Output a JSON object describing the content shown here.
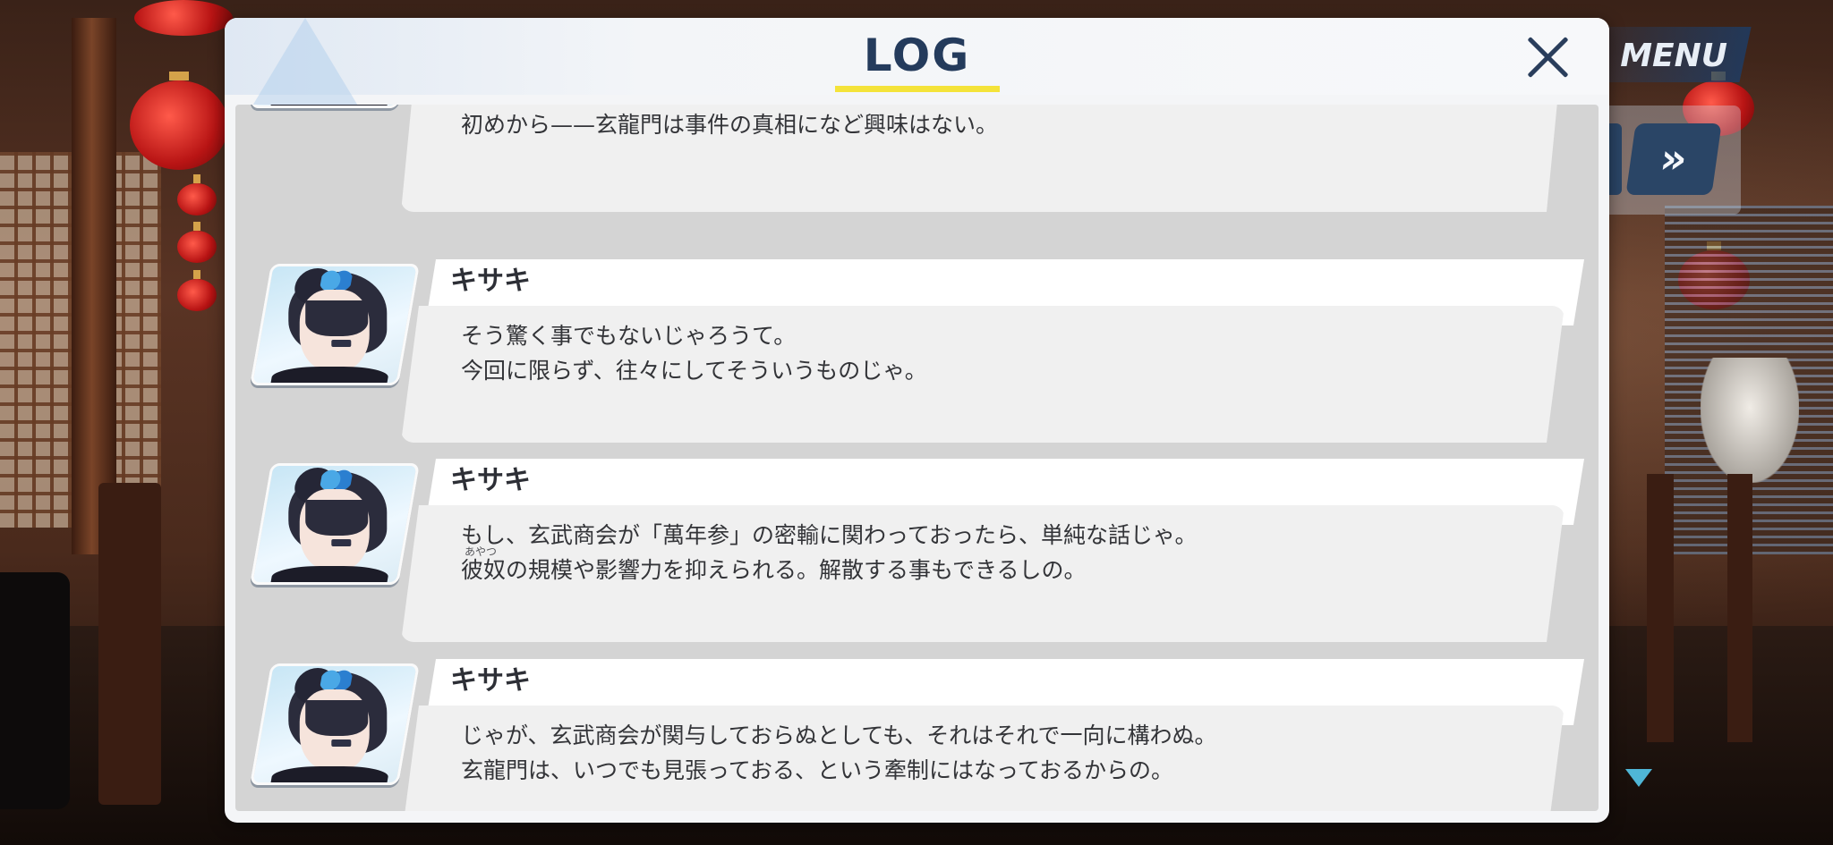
{
  "colors": {
    "title": "#243b5c",
    "title_underline": "#f4e33a",
    "speaker_text": "#2d2f36",
    "dialogue_text": "#333438",
    "menu_button": "#2a4566",
    "scroll_indicator": "#4fb6d6"
  },
  "hud": {
    "menu_label": "MENU",
    "fast_forward_icon": "»",
    "scroll_down_icon": "triangle-down-icon"
  },
  "log": {
    "title": "LOG",
    "close_icon": "close-icon",
    "entries": [
      {
        "speaker": "",
        "lines": [
          "初めから——玄龍門は事件の真相になど興味はない。"
        ]
      },
      {
        "speaker": "キサキ",
        "lines": [
          "そう驚く事でもないじゃろうて。",
          "今回に限らず、往々にしてそういうものじゃ。"
        ]
      },
      {
        "speaker": "キサキ",
        "ruby": "あやつ",
        "lines": [
          "もし、玄武商会が「萬年参」の密輸に関わっておったら、単純な話じゃ。",
          "彼奴の規模や影響力を抑えられる。解散する事もできるしの。"
        ]
      },
      {
        "speaker": "キサキ",
        "lines": [
          "じゃが、玄武商会が関与しておらぬとしても、それはそれで一向に構わぬ。",
          "玄龍門は、いつでも見張っておる、という牽制にはなっておるからの。"
        ]
      }
    ]
  }
}
